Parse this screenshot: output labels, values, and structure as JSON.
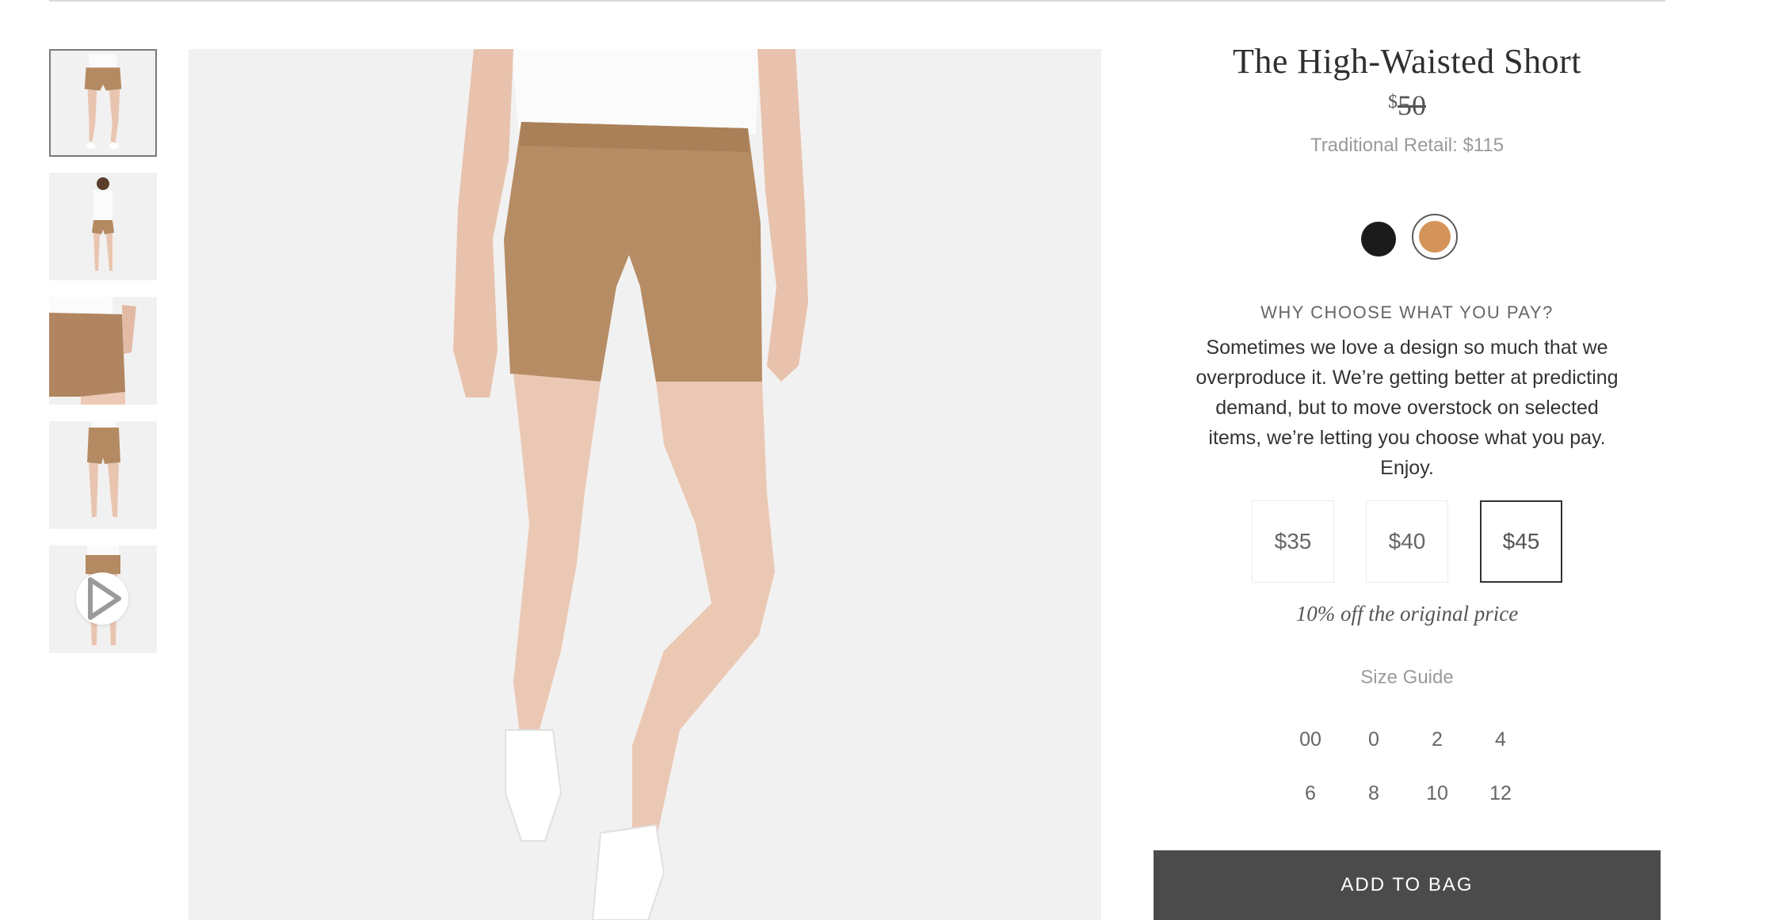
{
  "product": {
    "title": "The High-Waisted Short",
    "currency_symbol": "$",
    "original_price": "50",
    "traditional_retail": "Traditional Retail: $115"
  },
  "colors": [
    {
      "name": "black",
      "hex": "#1b1b1b",
      "selected": false
    },
    {
      "name": "tan",
      "hex": "#d49459",
      "selected": true
    }
  ],
  "choose_pay": {
    "heading": "WHY CHOOSE WHAT YOU PAY?",
    "description": "Sometimes we love a design so much that we overproduce it. We’re getting better at predicting demand, but to move overstock on selected items, we’re letting you choose what you pay. Enjoy.",
    "options": [
      {
        "label": "$35",
        "selected": false
      },
      {
        "label": "$40",
        "selected": false
      },
      {
        "label": "$45",
        "selected": true
      }
    ],
    "discount_note": "10% off the original price"
  },
  "sizes": {
    "guide_label": "Size Guide",
    "options": [
      "00",
      "0",
      "2",
      "4",
      "6",
      "8",
      "10",
      "12"
    ]
  },
  "cta": {
    "add_to_bag": "ADD TO BAG"
  },
  "gallery": {
    "thumbnails": [
      {
        "name": "thumbnail-front",
        "selected": true
      },
      {
        "name": "thumbnail-full-body",
        "selected": false
      },
      {
        "name": "thumbnail-side-pocket",
        "selected": false
      },
      {
        "name": "thumbnail-back",
        "selected": false
      },
      {
        "name": "thumbnail-video",
        "selected": false,
        "icon": "play-icon"
      }
    ]
  }
}
